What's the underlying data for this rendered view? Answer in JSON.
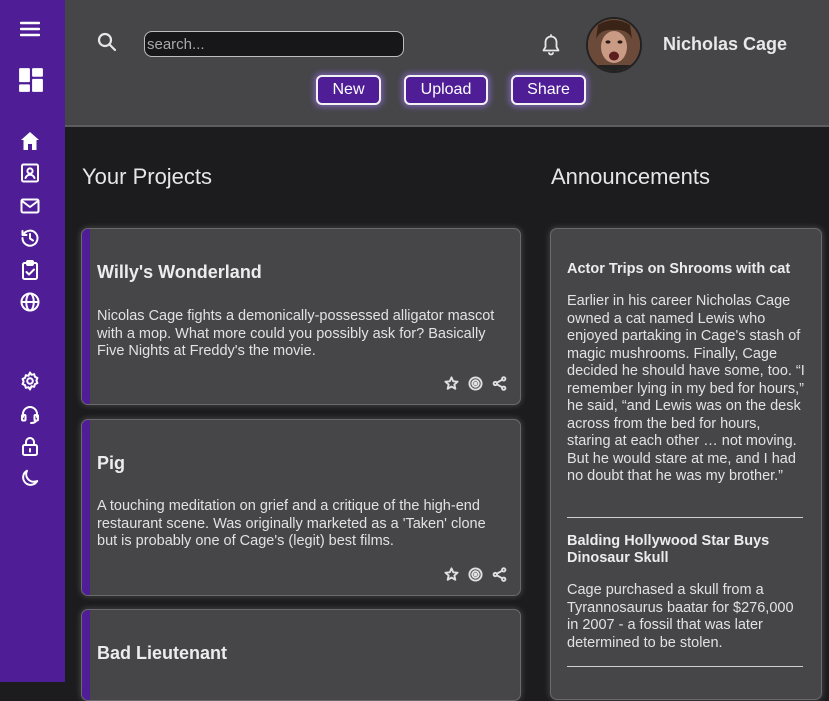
{
  "sidebar": {
    "items": [
      {
        "icon": "menu-icon"
      },
      {
        "icon": "dashboard-icon"
      },
      {
        "icon": "home-icon"
      },
      {
        "icon": "contact-card-icon"
      },
      {
        "icon": "mail-icon"
      },
      {
        "icon": "history-icon"
      },
      {
        "icon": "clipboard-check-icon"
      },
      {
        "icon": "globe-icon"
      },
      {
        "icon": "settings-icon"
      },
      {
        "icon": "headset-icon"
      },
      {
        "icon": "lock-icon"
      },
      {
        "icon": "moon-icon"
      }
    ],
    "color": "#4f1e97"
  },
  "header": {
    "search": {
      "placeholder": "search...",
      "value": ""
    },
    "username": "Nicholas Cage",
    "buttons": {
      "new": "New",
      "upload": "Upload",
      "share": "Share"
    }
  },
  "projects": {
    "title": "Your Projects",
    "items": [
      {
        "title": "Willy's Wonderland",
        "description": "Nicolas Cage fights a demonically-possessed alligator mascot with a mop. What more could you possibly ask for? Basically Five Nights at Freddy's the movie."
      },
      {
        "title": "Pig",
        "description": "A touching meditation on grief and a critique of the high-end restaurant scene. Was originally marketed as a 'Taken' clone but is probably one of Cage's (legit) best films."
      },
      {
        "title": "Bad Lieutenant",
        "description": ""
      }
    ]
  },
  "announcements": {
    "title": "Announcements",
    "items": [
      {
        "title": "Actor Trips on Shrooms with cat",
        "body": "Earlier in his career Nicholas Cage owned a cat named Lewis who enjoyed partaking in Cage's stash of magic mushrooms. Finally, Cage decided he should have some, too. “I remember lying in my bed for hours,” he said, “and Lewis was on the desk across from the bed for hours, staring at each other … not moving. But he would stare at me, and I had no doubt that he was my brother.”"
      },
      {
        "title": "Balding Hollywood Star Buys Dinosaur Skull",
        "body": "Cage purchased a skull from a Tyrannosaurus baatar for $276,000 in 2007 - a fossil that was later determined to be stolen."
      }
    ]
  },
  "colors": {
    "accent": "#4f1e97",
    "header_bg": "#464649",
    "page_bg": "#1c1c1e",
    "card_bg": "#464649"
  }
}
